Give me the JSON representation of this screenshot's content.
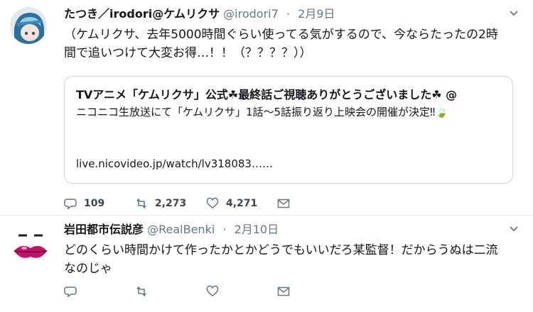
{
  "tweets": [
    {
      "author_name": "たつき／irodori@ケムリクサ",
      "handle": "@irodori7",
      "separator": "·",
      "date": "2月9日",
      "text": "（ケムリクサ、去年5000時間ぐらい使ってる気がするので、今ならたったの2時間で追いつけて大変お得…！！（？？？？））",
      "card": {
        "title": "TVアニメ「ケムリクサ」公式☘最終話ご視聴ありがとうございました☘ @",
        "description": "ニコニコ生放送にて「ケムリクサ」1話～5話振り返り上映会の開催が決定‼🍃",
        "url": "live.nicovideo.jp/watch/lv318083……"
      },
      "stats": {
        "replies": "109",
        "retweets": "2,273",
        "likes": "4,271"
      }
    },
    {
      "author_name": "岩田都市伝説彦",
      "handle": "@RealBenki",
      "separator": "·",
      "date": "2月10日",
      "text": "どのくらい時間かけて作ったかとかどうでもいいだろ某監督！だからうぬは二流なのじゃ",
      "stats": {
        "replies": "",
        "retweets": "",
        "likes": ""
      }
    }
  ],
  "colors": {
    "text": "#14171a",
    "muted": "#657786",
    "border": "#ccd6dd",
    "divider": "#e6ecf0",
    "lips": "#c4106a"
  },
  "icons": [
    "reply-icon",
    "retweet-icon",
    "like-icon",
    "dm-icon",
    "caret-down-icon"
  ]
}
